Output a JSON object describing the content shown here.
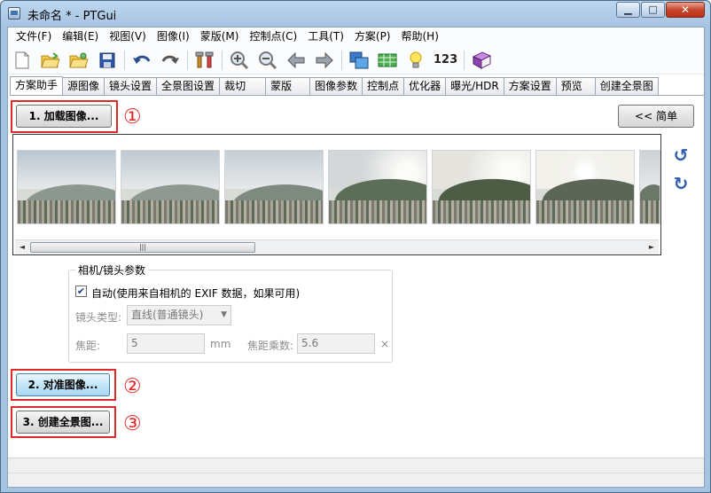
{
  "window": {
    "title": "未命名 * - PTGui"
  },
  "menu": [
    "文件(F)",
    "编辑(E)",
    "视图(V)",
    "图像(I)",
    "蒙版(M)",
    "控制点(C)",
    "工具(T)",
    "方案(P)",
    "帮助(H)"
  ],
  "toolbar": {
    "number_label": "123"
  },
  "tabs": [
    "方案助手",
    "源图像",
    "镜头设置",
    "全景图设置",
    "裁切",
    "蒙版",
    "图像参数",
    "控制点",
    "优化器",
    "曝光/HDR",
    "方案设置",
    "预览",
    "创建全景图"
  ],
  "buttons": {
    "load": "1. 加载图像...",
    "simple": "<< 简单",
    "align": "2. 对准图像...",
    "create": "3. 创建全景图..."
  },
  "step_markers": [
    "①",
    "②",
    "③"
  ],
  "scrollbar": {
    "thumb_grip": "|||",
    "left_arrow": "◄",
    "right_arrow": "►"
  },
  "thumbnails": [
    {
      "sky": "#b9c6d0",
      "mtn": "#8c978f",
      "haze": "light"
    },
    {
      "sky": "#bfc9d1",
      "mtn": "#8e9890",
      "haze": "light"
    },
    {
      "sky": "#c6ced4",
      "mtn": "#7e8a80",
      "haze": "light"
    },
    {
      "sky": "#d3d7d8",
      "mtn": "#5d6e58",
      "haze": "bright"
    },
    {
      "sky": "#e5e4df",
      "mtn": "#4d5c45",
      "haze": "bright"
    },
    {
      "sky": "#f2f1ec",
      "mtn": "#5c6657",
      "haze": "sun"
    },
    {
      "sky": "#cdd2d3",
      "mtn": "#6b7768",
      "haze": "light"
    }
  ],
  "lens": {
    "group_title": "相机/镜头参数",
    "auto_checked": true,
    "auto_label": "自动(使用来自相机的 EXIF 数据，如果可用)",
    "lens_type_label": "镜头类型:",
    "lens_type_value": "直线(普通镜头)",
    "focal_label": "焦距:",
    "focal_value": "5",
    "focal_unit": "mm",
    "multiplier_label": "焦距乘数:",
    "multiplier_value": "5.6",
    "multiplier_suffix": "×"
  },
  "colors": {
    "marker_red": "#e02a2a",
    "accent_blue": "#2f5cac"
  }
}
